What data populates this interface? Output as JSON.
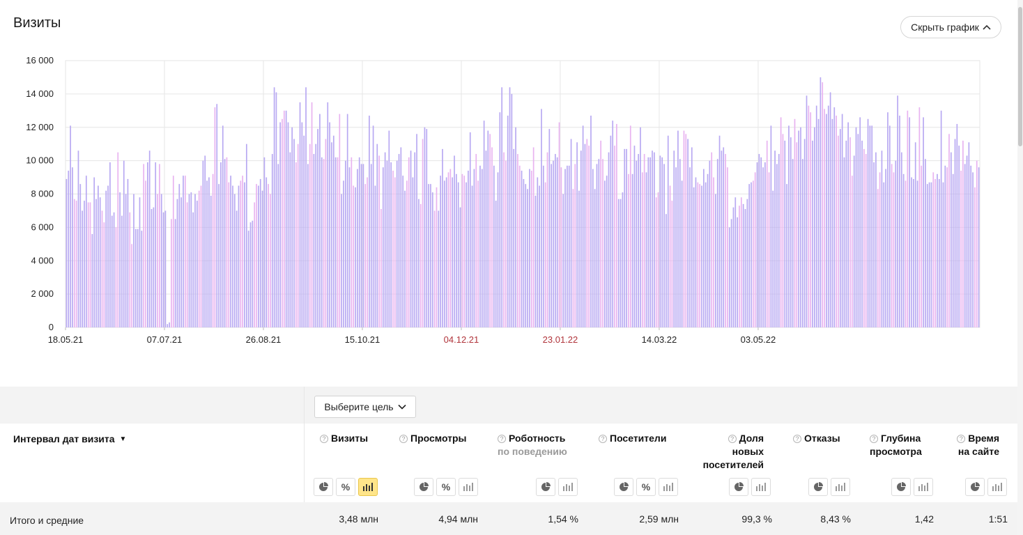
{
  "title": "Визиты",
  "hide_chart_label": "Скрыть график",
  "goal_select": "Выберите цель",
  "dimension_header": "Интервал дат визита",
  "metrics": [
    {
      "name": "Визиты",
      "sub": "",
      "total": "3,48 млн"
    },
    {
      "name": "Просмотры",
      "sub": "",
      "total": "4,94 млн"
    },
    {
      "name": "Роботность",
      "sub": "по поведению",
      "total": "1,54 %"
    },
    {
      "name": "Посетители",
      "sub": "",
      "total": "2,59 млн"
    },
    {
      "name": "Доля новых посетителей",
      "sub": "",
      "total": "99,3 %"
    },
    {
      "name": "Отказы",
      "sub": "",
      "total": "8,43 %"
    },
    {
      "name": "Глубина просмотра",
      "sub": "",
      "total": "1,42"
    },
    {
      "name": "Время на сайте",
      "sub": "",
      "total": "1:51"
    }
  ],
  "totals_label": "Итого и средние",
  "colors": {
    "bar_weekday": "#b8a9f2",
    "bar_weekend": "#e8b3f0",
    "grid": "#e6e6e6",
    "tick_holiday": "#b0333a",
    "active_icon": "#ffe58a"
  },
  "chart_data": {
    "type": "bar",
    "title": "Визиты",
    "ylim": [
      0,
      16000
    ],
    "yticks": [
      0,
      2000,
      4000,
      6000,
      8000,
      10000,
      12000,
      14000,
      16000
    ],
    "ytick_labels": [
      "0",
      "2 000",
      "4 000",
      "6 000",
      "8 000",
      "10 000",
      "12 000",
      "14 000",
      "16 000"
    ],
    "xtick_labels": [
      "18.05.21",
      "07.07.21",
      "26.08.21",
      "15.10.21",
      "04.12.21",
      "23.01.22",
      "14.03.22",
      "03.05.22"
    ],
    "xtick_holiday": [
      false,
      false,
      false,
      false,
      true,
      true,
      false,
      false
    ],
    "xtick_interval_days": 50,
    "start_date": "18.05.21",
    "end_date": "22.05.22",
    "grid": true,
    "legend": "none",
    "values": [
      8900,
      9400,
      12100,
      9600,
      7700,
      7600,
      10600,
      8600,
      7000,
      7600,
      9100,
      7500,
      7500,
      5600,
      9000,
      7700,
      8500,
      7800,
      7000,
      6300,
      8200,
      8500,
      9900,
      6700,
      6900,
      6000,
      10500,
      8100,
      6700,
      10000,
      8000,
      8900,
      6900,
      5000,
      8000,
      5900,
      5900,
      7800,
      5800,
      9800,
      8800,
      9900,
      10600,
      7100,
      7200,
      9900,
      8000,
      9800,
      8000,
      6900,
      7000,
      200,
      300,
      6500,
      9100,
      6500,
      7700,
      8600,
      7800,
      9100,
      9100,
      7500,
      8000,
      8100,
      6900,
      8000,
      7600,
      8200,
      8500,
      10000,
      10300,
      8800,
      9000,
      7900,
      9200,
      13200,
      13400,
      8600,
      9900,
      12100,
      10100,
      10200,
      8700,
      9100,
      8500,
      8000,
      7000,
      8500,
      8800,
      9100,
      8700,
      11000,
      5800,
      6300,
      6400,
      7500,
      8600,
      8500,
      8900,
      8200,
      10200,
      9000,
      8600,
      8000,
      10400,
      14400,
      14100,
      9800,
      12300,
      12500,
      13000,
      13000,
      12300,
      10500,
      12000,
      11300,
      9900,
      11000,
      13500,
      12300,
      11500,
      14400,
      9800,
      11000,
      13500,
      10400,
      11000,
      11900,
      12800,
      10200,
      10100,
      11300,
      13500,
      12300,
      11100,
      11500,
      10200,
      10200,
      12800,
      8000,
      8800,
      10000,
      12800,
      9600,
      10200,
      8500,
      8400,
      9500,
      10200,
      9800,
      9800,
      8600,
      9000,
      12700,
      9800,
      12100,
      8500,
      11000,
      10300,
      7100,
      9600,
      10500,
      10000,
      11800,
      9900,
      9400,
      9000,
      10000,
      10400,
      10800,
      9100,
      8200,
      8800,
      10200,
      10600,
      9000,
      10500,
      11600,
      7700,
      7400,
      11300,
      12000,
      11900,
      8600,
      8600,
      8100,
      7000,
      8400,
      7000,
      9100,
      10700,
      8800,
      9000,
      9300,
      9500,
      9000,
      10300,
      9200,
      8700,
      7200,
      9200,
      9100,
      8700,
      9400,
      11700,
      8500,
      9500,
      10400,
      8800,
      9700,
      9500,
      12400,
      10600,
      11800,
      11600,
      10800,
      9700,
      7600,
      9300,
      12900,
      14400,
      10500,
      10000,
      12700,
      14400,
      14000,
      10700,
      12000,
      10400,
      9700,
      9400,
      8900,
      8600,
      8300,
      9500,
      9400,
      10800,
      7900,
      9000,
      8500,
      13100,
      9700,
      8700,
      10500,
      11900,
      9800,
      10000,
      10400,
      10200,
      12300,
      9600,
      8000,
      9500,
      9700,
      9700,
      11300,
      8300,
      9800,
      11100,
      8200,
      10600,
      12100,
      11000,
      11300,
      10900,
      12700,
      9500,
      8300,
      9800,
      10100,
      11200,
      10100,
      8800,
      9100,
      10500,
      11500,
      12400,
      10900,
      12200,
      7700,
      7700,
      8100,
      10700,
      10700,
      9200,
      12100,
      9200,
      10900,
      10000,
      10400,
      12000,
      9300,
      10400,
      9300,
      10200,
      10200,
      10600,
      10500,
      7800,
      8100,
      10300,
      10200,
      9800,
      6800,
      11500,
      8500,
      7600,
      10600,
      9600,
      11800,
      10100,
      8800,
      11800,
      11600,
      11300,
      9600,
      10800,
      8400,
      9000,
      8700,
      8600,
      8500,
      9500,
      8700,
      9200,
      10000,
      10500,
      9000,
      8000,
      10100,
      11500,
      10600,
      10800,
      10400,
      9600,
      6000,
      6500,
      7200,
      7800,
      6600,
      7300,
      7800,
      7400,
      7100,
      7700,
      8600,
      8700,
      8800,
      9300,
      9900,
      10400,
      10200,
      9600,
      9900,
      11200,
      9300,
      12100,
      8200,
      10600,
      9800,
      10400,
      12600,
      11600,
      11200,
      8600,
      12100,
      11400,
      10100,
      12500,
      11100,
      11800,
      12000,
      10100,
      11300,
      13900,
      13300,
      12900,
      11200,
      12000,
      13300,
      12500,
      15000,
      14700,
      13100,
      12800,
      13300,
      14100,
      12500,
      13200,
      12700,
      11500,
      11900,
      12800,
      10200,
      11200,
      12300,
      11400,
      9100,
      10300,
      12000,
      11600,
      12600,
      11200,
      10700,
      10400,
      12500,
      12100,
      12100,
      9900,
      10500,
      8300,
      9300,
      10600,
      8700,
      9500,
      12900,
      12100,
      9800,
      9300,
      10000,
      13900,
      12700,
      10500,
      9200,
      8800,
      13000,
      12600,
      9000,
      8900,
      11100,
      8800,
      13200,
      9700,
      12600,
      10100,
      8600,
      8700,
      8700,
      9300,
      8900,
      9200,
      8900,
      13000,
      8700,
      9700,
      9600,
      11600,
      10500,
      9200,
      11300,
      12200,
      10900,
      9400,
      11200,
      9800,
      10300,
      11100,
      9700,
      9300,
      8400,
      10000,
      9600
    ]
  }
}
